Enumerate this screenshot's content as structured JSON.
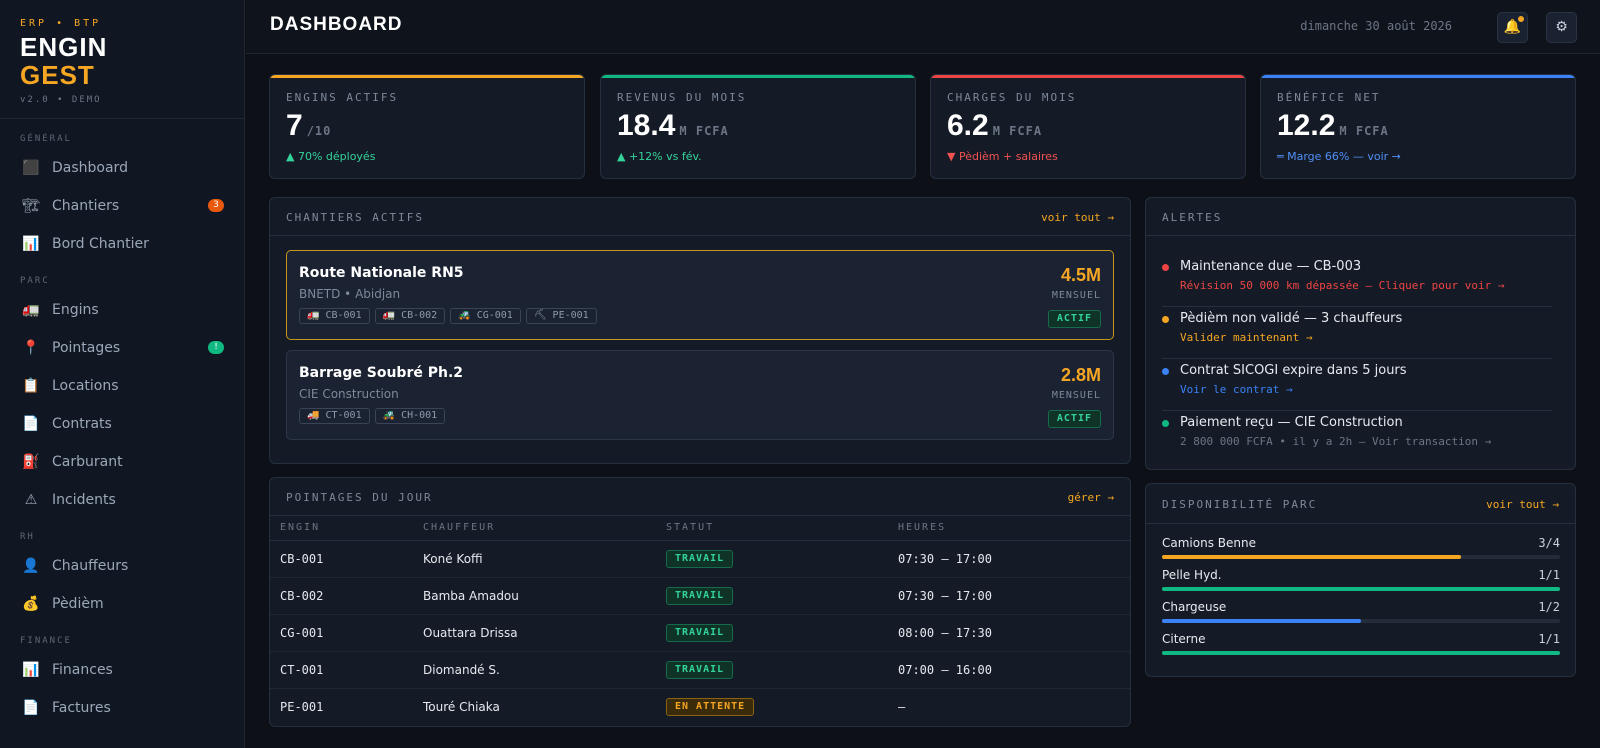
{
  "brand": {
    "tagline": "ERP • BTP",
    "line1": "ENGIN",
    "line2": "GEST",
    "version": "v2.0 • DEMO"
  },
  "sidebar": {
    "sections": [
      {
        "title": "GÉNÉRAL",
        "items": [
          {
            "label": "Dashboard",
            "icon": "dashboard-icon",
            "glyph": "⬛"
          },
          {
            "label": "Chantiers",
            "icon": "construction-icon",
            "glyph": "🏗",
            "badge": "3",
            "badge_color": "#e8590c"
          },
          {
            "label": "Bord Chantier",
            "icon": "chart-icon",
            "glyph": "📊"
          }
        ]
      },
      {
        "title": "PARC",
        "items": [
          {
            "label": "Engins",
            "icon": "truck-icon",
            "glyph": "🚛"
          },
          {
            "label": "Pointages",
            "icon": "pin-icon",
            "glyph": "📍",
            "badge": "!",
            "badge_color": "#10b981"
          },
          {
            "label": "Locations",
            "icon": "clipboard-icon",
            "glyph": "📋"
          },
          {
            "label": "Contrats",
            "icon": "document-icon",
            "glyph": "📄"
          },
          {
            "label": "Carburant",
            "icon": "fuel-icon",
            "glyph": "⛽"
          },
          {
            "label": "Incidents",
            "icon": "warning-icon",
            "glyph": "⚠"
          }
        ]
      },
      {
        "title": "RH",
        "items": [
          {
            "label": "Chauffeurs",
            "icon": "user-icon",
            "glyph": "👤"
          },
          {
            "label": "Pèdièm",
            "icon": "money-bag-icon",
            "glyph": "💰"
          }
        ]
      },
      {
        "title": "FINANCE",
        "items": [
          {
            "label": "Finances",
            "icon": "chart-icon",
            "glyph": "📊"
          },
          {
            "label": "Factures",
            "icon": "document-icon",
            "glyph": "📄"
          }
        ]
      }
    ]
  },
  "header": {
    "title": "DASHBOARD",
    "date": "dimanche 30 août 2026",
    "bell_icon": "bell-icon",
    "settings_icon": "gear-icon"
  },
  "kpis": [
    {
      "label": "ENGINS ACTIFS",
      "value": "7",
      "unit": "/10",
      "trend": "▲ 70% déployés",
      "color": "#f5a623",
      "trend_color": "#34d399"
    },
    {
      "label": "REVENUS DU MOIS",
      "value": "18.4",
      "unit": "M FCFA",
      "trend": "▲ +12% vs fév.",
      "color": "#10b981",
      "trend_color": "#34d399"
    },
    {
      "label": "CHARGES DU MOIS",
      "value": "6.2",
      "unit": "M FCFA",
      "trend": "▼ Pèdièm + salaires",
      "color": "#ef4444",
      "trend_color": "#f05252"
    },
    {
      "label": "BÉNÉFICE NET",
      "value": "12.2",
      "unit": "M FCFA",
      "trend": "═ Marge 66% — voir →",
      "color": "#3b82f6",
      "trend_color": "#4f8ff7"
    }
  ],
  "chantiers": {
    "title": "CHANTIERS ACTIFS",
    "link": "voir tout →",
    "sites": [
      {
        "name": "Route Nationale RN5",
        "client": "BNETD • Abidjan",
        "amount": "4.5M",
        "period": "MENSUEL",
        "status": "ACTIF",
        "engins": [
          "🚛 CB-001",
          "🚛 CB-002",
          "🚜 CG-001",
          "⛏ PE-001"
        ]
      },
      {
        "name": "Barrage Soubré Ph.2",
        "client": "CIE Construction",
        "amount": "2.8M",
        "period": "MENSUEL",
        "status": "ACTIF",
        "engins": [
          "🚚 CT-001",
          "🚜 CH-001"
        ]
      }
    ]
  },
  "pointages": {
    "title": "POINTAGES DU JOUR",
    "link": "gérer →",
    "columns": [
      "ENGIN",
      "CHAUFFEUR",
      "STATUT",
      "HEURES"
    ],
    "rows": [
      {
        "engin": "CB-001",
        "chauffeur": "Koné Koffi",
        "statut": "TRAVAIL",
        "heures": "07:30 – 17:00"
      },
      {
        "engin": "CB-002",
        "chauffeur": "Bamba Amadou",
        "statut": "TRAVAIL",
        "heures": "07:30 – 17:00"
      },
      {
        "engin": "CG-001",
        "chauffeur": "Ouattara Drissa",
        "statut": "TRAVAIL",
        "heures": "08:00 – 17:30"
      },
      {
        "engin": "CT-001",
        "chauffeur": "Diomandé S.",
        "statut": "TRAVAIL",
        "heures": "07:00 – 16:00"
      },
      {
        "engin": "PE-001",
        "chauffeur": "Touré Chiaka",
        "statut": "EN ATTENTE",
        "heures": "—"
      }
    ]
  },
  "alertes": {
    "title": "ALERTES",
    "items": [
      {
        "title": "Maintenance due — CB-003",
        "sub": "Révision 50 000 km dépassée — Cliquer pour voir →",
        "color": "#ef4444"
      },
      {
        "title": "Pèdièm non validé — 3 chauffeurs",
        "sub": "Valider maintenant →",
        "color": "#f5a623"
      },
      {
        "title": "Contrat SICOGI expire dans 5 jours",
        "sub": "Voir le contrat →",
        "color": "#3b82f6"
      },
      {
        "title": "Paiement reçu — CIE Construction",
        "sub": "2 800 000 FCFA • il y a 2h — Voir transaction →",
        "color": "#10b981",
        "sub_color": "#6b7585"
      }
    ]
  },
  "disponibilite": {
    "title": "DISPONIBILITÉ PARC",
    "link": "voir tout →",
    "items": [
      {
        "name": "Camions Benne",
        "value": "3/4",
        "ratio": 0.75,
        "color": "#f5a623"
      },
      {
        "name": "Pelle Hyd.",
        "value": "1/1",
        "ratio": 1.0,
        "color": "#10b981"
      },
      {
        "name": "Chargeuse",
        "value": "1/2",
        "ratio": 0.5,
        "color": "#3b82f6"
      },
      {
        "name": "Citerne",
        "value": "1/1",
        "ratio": 1.0,
        "color": "#10b981"
      }
    ]
  }
}
